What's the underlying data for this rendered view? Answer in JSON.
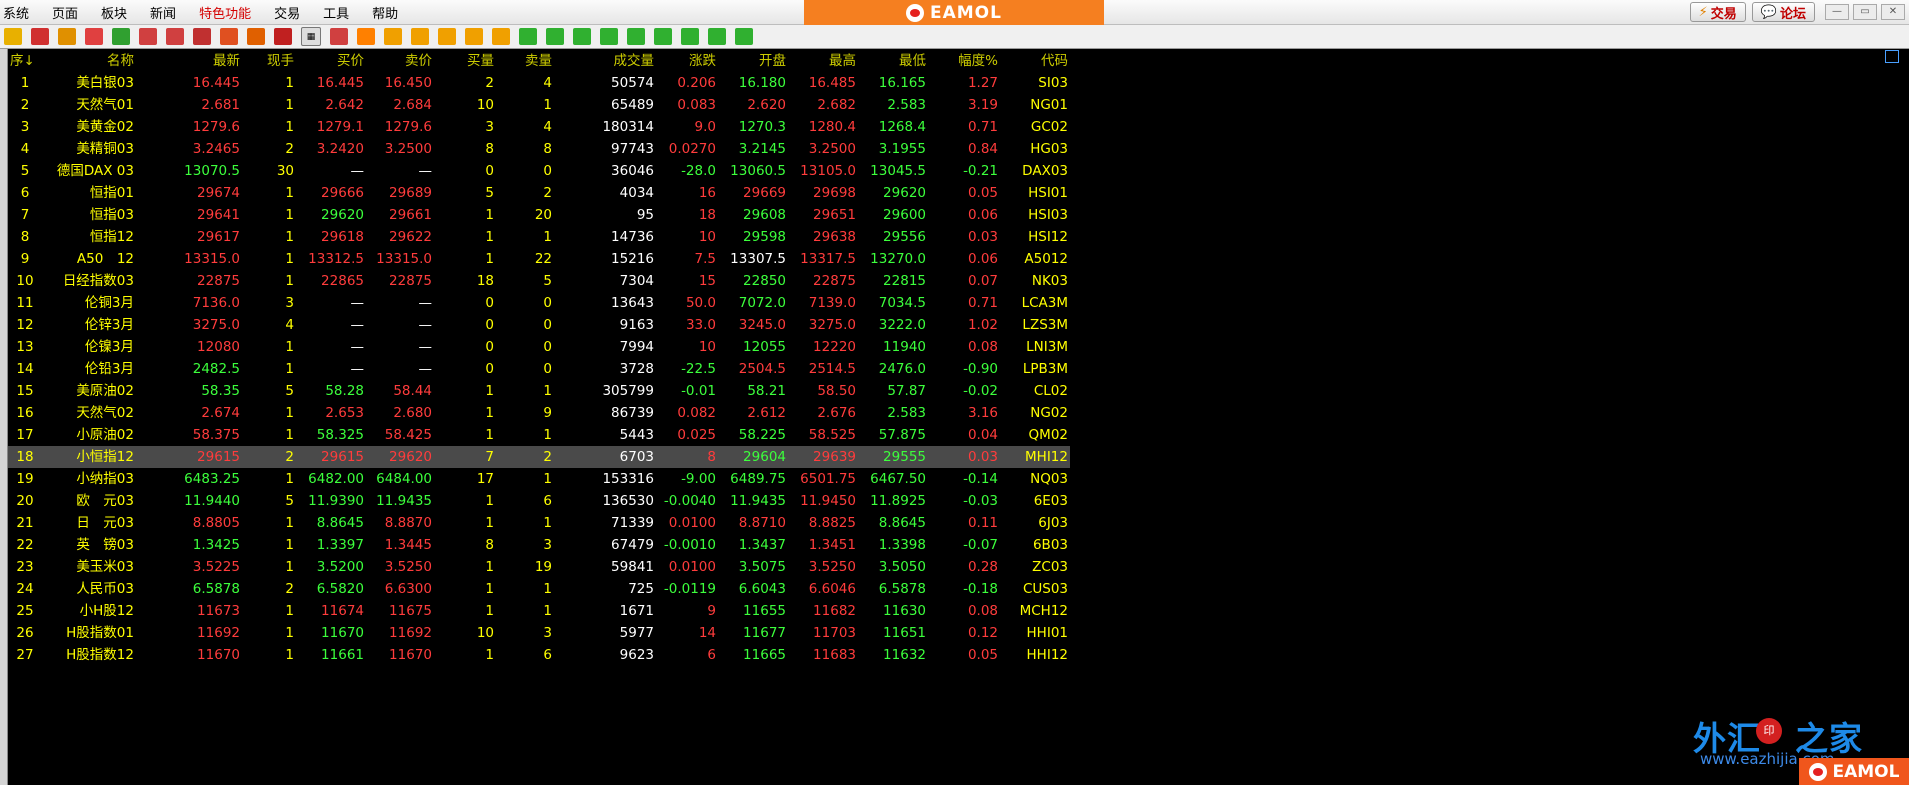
{
  "menu": {
    "items": [
      "系统",
      "页面",
      "板块",
      "新闻",
      "特色功能",
      "交易",
      "工具",
      "帮助"
    ],
    "highlight_index": 4
  },
  "brand": {
    "text": "EAMOL"
  },
  "top_right": {
    "trade_label": "交易",
    "forum_label": "论坛"
  },
  "toolbar_icons": [
    {
      "icon": "folder-icon",
      "color": "#e8b000",
      "label": ""
    },
    {
      "icon": "home-icon",
      "color": "#d03030",
      "label": ""
    },
    {
      "icon": "book-icon",
      "color": "#e09000",
      "label": ""
    },
    {
      "icon": "card-icon",
      "color": "#e04040",
      "label": ""
    },
    {
      "icon": "refresh-icon",
      "color": "#30a030",
      "label": ""
    },
    {
      "icon": "zoom-in-icon",
      "color": "#d04040",
      "label": ""
    },
    {
      "icon": "zoom-out-icon",
      "color": "#d04040",
      "label": ""
    },
    {
      "icon": "window-icon",
      "color": "#c03030",
      "label": ""
    },
    {
      "icon": "pen-icon",
      "color": "#e05020",
      "label": ""
    },
    {
      "icon": "paint-icon",
      "color": "#e06000",
      "label": ""
    },
    {
      "icon": "filter-icon",
      "color": "#c02020",
      "label": ""
    },
    {
      "icon": "table-view-icon",
      "color": "#888888",
      "label": ""
    },
    {
      "icon": "line-chart-icon",
      "color": "#d04040",
      "label": ""
    },
    {
      "icon": "minute-chart-icon",
      "color": "#ff8000",
      "label": ""
    },
    {
      "icon": "daily-chart-icon",
      "color": "#f0a000",
      "label": ""
    },
    {
      "icon": "weekly-chart-icon",
      "color": "#f0a000",
      "label": ""
    },
    {
      "icon": "monthly-chart-icon",
      "color": "#f0a000",
      "label": ""
    },
    {
      "icon": "quarterly-chart-icon",
      "color": "#f0a000",
      "label": ""
    },
    {
      "icon": "yearly-chart-icon",
      "color": "#f0a000",
      "label": ""
    },
    {
      "icon": "period-1-icon",
      "color": "#30b030",
      "label": ""
    },
    {
      "icon": "period-3-icon",
      "color": "#30b030",
      "label": ""
    },
    {
      "icon": "period-5-icon",
      "color": "#30b030",
      "label": ""
    },
    {
      "icon": "period-15-icon",
      "color": "#30b030",
      "label": ""
    },
    {
      "icon": "period-30-icon",
      "color": "#30b030",
      "label": ""
    },
    {
      "icon": "period-60-icon",
      "color": "#30b030",
      "label": ""
    },
    {
      "icon": "period-2h-icon",
      "color": "#30b030",
      "label": ""
    },
    {
      "icon": "period-4h-icon",
      "color": "#30b030",
      "label": ""
    },
    {
      "icon": "period-custom-icon",
      "color": "#30b030",
      "label": ""
    }
  ],
  "table": {
    "headers": [
      "序↓",
      "名称",
      "最新",
      "现手",
      "买价",
      "卖价",
      "买量",
      "卖量",
      "成交量",
      "涨跌",
      "开盘",
      "最高",
      "最低",
      "幅度%",
      "代码"
    ],
    "selected_row": 17,
    "rows": [
      {
        "idx": "1",
        "name": "美白银03",
        "last": "16.445",
        "hand": "1",
        "bid": "16.445",
        "ask": "16.450",
        "bidv": "2",
        "askv": "4",
        "vol": "50574",
        "chg": "0.206",
        "open": "16.180",
        "high": "16.485",
        "low": "16.165",
        "pct": "1.27",
        "code": "SI03",
        "dir": "up",
        "open_dir": "down",
        "high_dir": "up",
        "low_dir": "down",
        "bid_dir": "up",
        "ask_dir": "up"
      },
      {
        "idx": "2",
        "name": "天然气01",
        "last": "2.681",
        "hand": "1",
        "bid": "2.642",
        "ask": "2.684",
        "bidv": "10",
        "askv": "1",
        "vol": "65489",
        "chg": "0.083",
        "open": "2.620",
        "high": "2.682",
        "low": "2.583",
        "pct": "3.19",
        "code": "NG01",
        "dir": "up",
        "open_dir": "up",
        "high_dir": "up",
        "low_dir": "down",
        "bid_dir": "up",
        "ask_dir": "up"
      },
      {
        "idx": "3",
        "name": "美黄金02",
        "last": "1279.6",
        "hand": "1",
        "bid": "1279.1",
        "ask": "1279.6",
        "bidv": "3",
        "askv": "4",
        "vol": "180314",
        "chg": "9.0",
        "open": "1270.3",
        "high": "1280.4",
        "low": "1268.4",
        "pct": "0.71",
        "code": "GC02",
        "dir": "up",
        "open_dir": "down",
        "high_dir": "up",
        "low_dir": "down",
        "bid_dir": "up",
        "ask_dir": "up"
      },
      {
        "idx": "4",
        "name": "美精铜03",
        "last": "3.2465",
        "hand": "2",
        "bid": "3.2420",
        "ask": "3.2500",
        "bidv": "8",
        "askv": "8",
        "vol": "97743",
        "chg": "0.0270",
        "open": "3.2145",
        "high": "3.2500",
        "low": "3.1955",
        "pct": "0.84",
        "code": "HG03",
        "dir": "up",
        "open_dir": "down",
        "high_dir": "up",
        "low_dir": "down",
        "bid_dir": "up",
        "ask_dir": "up"
      },
      {
        "idx": "5",
        "name": "德国DAX 03",
        "last": "13070.5",
        "hand": "30",
        "bid": "—",
        "ask": "—",
        "bidv": "0",
        "askv": "0",
        "vol": "36046",
        "chg": "-28.0",
        "open": "13060.5",
        "high": "13105.0",
        "low": "13045.5",
        "pct": "-0.21",
        "code": "DAX03",
        "dir": "down",
        "open_dir": "down",
        "high_dir": "up",
        "low_dir": "down",
        "bid_dir": "neu",
        "ask_dir": "neu"
      },
      {
        "idx": "6",
        "name": "恒指01",
        "last": "29674",
        "hand": "1",
        "bid": "29666",
        "ask": "29689",
        "bidv": "5",
        "askv": "2",
        "vol": "4034",
        "chg": "16",
        "open": "29669",
        "high": "29698",
        "low": "29620",
        "pct": "0.05",
        "code": "HSI01",
        "dir": "up",
        "open_dir": "up",
        "high_dir": "up",
        "low_dir": "down",
        "bid_dir": "up",
        "ask_dir": "up"
      },
      {
        "idx": "7",
        "name": "恒指03",
        "last": "29641",
        "hand": "1",
        "bid": "29620",
        "ask": "29661",
        "bidv": "1",
        "askv": "20",
        "vol": "95",
        "chg": "18",
        "open": "29608",
        "high": "29651",
        "low": "29600",
        "pct": "0.06",
        "code": "HSI03",
        "dir": "up",
        "open_dir": "down",
        "high_dir": "up",
        "low_dir": "down",
        "bid_dir": "down",
        "ask_dir": "up"
      },
      {
        "idx": "8",
        "name": "恒指12",
        "last": "29617",
        "hand": "1",
        "bid": "29618",
        "ask": "29622",
        "bidv": "1",
        "askv": "1",
        "vol": "14736",
        "chg": "10",
        "open": "29598",
        "high": "29638",
        "low": "29556",
        "pct": "0.03",
        "code": "HSI12",
        "dir": "up",
        "open_dir": "down",
        "high_dir": "up",
        "low_dir": "down",
        "bid_dir": "up",
        "ask_dir": "up"
      },
      {
        "idx": "9",
        "name": "A50　12",
        "last": "13315.0",
        "hand": "1",
        "bid": "13312.5",
        "ask": "13315.0",
        "bidv": "1",
        "askv": "22",
        "vol": "15216",
        "chg": "7.5",
        "open": "13307.5",
        "high": "13317.5",
        "low": "13270.0",
        "pct": "0.06",
        "code": "A5012",
        "dir": "up",
        "open_dir": "neu",
        "high_dir": "up",
        "low_dir": "down",
        "bid_dir": "up",
        "ask_dir": "up"
      },
      {
        "idx": "10",
        "name": "日经指数03",
        "last": "22875",
        "hand": "1",
        "bid": "22865",
        "ask": "22875",
        "bidv": "18",
        "askv": "5",
        "vol": "7304",
        "chg": "15",
        "open": "22850",
        "high": "22875",
        "low": "22815",
        "pct": "0.07",
        "code": "NK03",
        "dir": "up",
        "open_dir": "down",
        "high_dir": "up",
        "low_dir": "down",
        "bid_dir": "up",
        "ask_dir": "up"
      },
      {
        "idx": "11",
        "name": "伦铜3月",
        "last": "7136.0",
        "hand": "3",
        "bid": "—",
        "ask": "—",
        "bidv": "0",
        "askv": "0",
        "vol": "13643",
        "chg": "50.0",
        "open": "7072.0",
        "high": "7139.0",
        "low": "7034.5",
        "pct": "0.71",
        "code": "LCA3M",
        "dir": "up",
        "open_dir": "down",
        "high_dir": "up",
        "low_dir": "down",
        "bid_dir": "neu",
        "ask_dir": "neu"
      },
      {
        "idx": "12",
        "name": "伦锌3月",
        "last": "3275.0",
        "hand": "4",
        "bid": "—",
        "ask": "—",
        "bidv": "0",
        "askv": "0",
        "vol": "9163",
        "chg": "33.0",
        "open": "3245.0",
        "high": "3275.0",
        "low": "3222.0",
        "pct": "1.02",
        "code": "LZS3M",
        "dir": "up",
        "open_dir": "up",
        "high_dir": "up",
        "low_dir": "down",
        "bid_dir": "neu",
        "ask_dir": "neu"
      },
      {
        "idx": "13",
        "name": "伦镍3月",
        "last": "12080",
        "hand": "1",
        "bid": "—",
        "ask": "—",
        "bidv": "0",
        "askv": "0",
        "vol": "7994",
        "chg": "10",
        "open": "12055",
        "high": "12220",
        "low": "11940",
        "pct": "0.08",
        "code": "LNI3M",
        "dir": "up",
        "open_dir": "down",
        "high_dir": "up",
        "low_dir": "down",
        "bid_dir": "neu",
        "ask_dir": "neu"
      },
      {
        "idx": "14",
        "name": "伦铅3月",
        "last": "2482.5",
        "hand": "1",
        "bid": "—",
        "ask": "—",
        "bidv": "0",
        "askv": "0",
        "vol": "3728",
        "chg": "-22.5",
        "open": "2504.5",
        "high": "2514.5",
        "low": "2476.0",
        "pct": "-0.90",
        "code": "LPB3M",
        "dir": "down",
        "open_dir": "up",
        "high_dir": "up",
        "low_dir": "down",
        "bid_dir": "neu",
        "ask_dir": "neu"
      },
      {
        "idx": "15",
        "name": "美原油02",
        "last": "58.35",
        "hand": "5",
        "bid": "58.28",
        "ask": "58.44",
        "bidv": "1",
        "askv": "1",
        "vol": "305799",
        "chg": "-0.01",
        "open": "58.21",
        "high": "58.50",
        "low": "57.87",
        "pct": "-0.02",
        "code": "CL02",
        "dir": "down",
        "open_dir": "down",
        "high_dir": "up",
        "low_dir": "down",
        "bid_dir": "down",
        "ask_dir": "up"
      },
      {
        "idx": "16",
        "name": "天然气02",
        "last": "2.674",
        "hand": "1",
        "bid": "2.653",
        "ask": "2.680",
        "bidv": "1",
        "askv": "9",
        "vol": "86739",
        "chg": "0.082",
        "open": "2.612",
        "high": "2.676",
        "low": "2.583",
        "pct": "3.16",
        "code": "NG02",
        "dir": "up",
        "open_dir": "up",
        "high_dir": "up",
        "low_dir": "down",
        "bid_dir": "up",
        "ask_dir": "up"
      },
      {
        "idx": "17",
        "name": "小原油02",
        "last": "58.375",
        "hand": "1",
        "bid": "58.325",
        "ask": "58.425",
        "bidv": "1",
        "askv": "1",
        "vol": "5443",
        "chg": "0.025",
        "open": "58.225",
        "high": "58.525",
        "low": "57.875",
        "pct": "0.04",
        "code": "QM02",
        "dir": "up",
        "open_dir": "down",
        "high_dir": "up",
        "low_dir": "down",
        "bid_dir": "down",
        "ask_dir": "up"
      },
      {
        "idx": "18",
        "name": "小恒指12",
        "last": "29615",
        "hand": "2",
        "bid": "29615",
        "ask": "29620",
        "bidv": "7",
        "askv": "2",
        "vol": "6703",
        "chg": "8",
        "open": "29604",
        "high": "29639",
        "low": "29555",
        "pct": "0.03",
        "code": "MHI12",
        "dir": "up",
        "open_dir": "down",
        "high_dir": "up",
        "low_dir": "down",
        "bid_dir": "up",
        "ask_dir": "up"
      },
      {
        "idx": "19",
        "name": "小纳指03",
        "last": "6483.25",
        "hand": "1",
        "bid": "6482.00",
        "ask": "6484.00",
        "bidv": "17",
        "askv": "1",
        "vol": "153316",
        "chg": "-9.00",
        "open": "6489.75",
        "high": "6501.75",
        "low": "6467.50",
        "pct": "-0.14",
        "code": "NQ03",
        "dir": "down",
        "open_dir": "down",
        "high_dir": "up",
        "low_dir": "down",
        "bid_dir": "down",
        "ask_dir": "down"
      },
      {
        "idx": "20",
        "name": "欧　元03",
        "last": "11.9440",
        "hand": "5",
        "bid": "11.9390",
        "ask": "11.9435",
        "bidv": "1",
        "askv": "6",
        "vol": "136530",
        "chg": "-0.0040",
        "open": "11.9435",
        "high": "11.9450",
        "low": "11.8925",
        "pct": "-0.03",
        "code": "6E03",
        "dir": "down",
        "open_dir": "down",
        "high_dir": "up",
        "low_dir": "down",
        "bid_dir": "down",
        "ask_dir": "down"
      },
      {
        "idx": "21",
        "name": "日　元03",
        "last": "8.8805",
        "hand": "1",
        "bid": "8.8645",
        "ask": "8.8870",
        "bidv": "1",
        "askv": "1",
        "vol": "71339",
        "chg": "0.0100",
        "open": "8.8710",
        "high": "8.8825",
        "low": "8.8645",
        "pct": "0.11",
        "code": "6J03",
        "dir": "up",
        "open_dir": "up",
        "high_dir": "up",
        "low_dir": "down",
        "bid_dir": "down",
        "ask_dir": "up"
      },
      {
        "idx": "22",
        "name": "英　镑03",
        "last": "1.3425",
        "hand": "1",
        "bid": "1.3397",
        "ask": "1.3445",
        "bidv": "8",
        "askv": "3",
        "vol": "67479",
        "chg": "-0.0010",
        "open": "1.3437",
        "high": "1.3451",
        "low": "1.3398",
        "pct": "-0.07",
        "code": "6B03",
        "dir": "down",
        "open_dir": "down",
        "high_dir": "up",
        "low_dir": "down",
        "bid_dir": "down",
        "ask_dir": "up"
      },
      {
        "idx": "23",
        "name": "美玉米03",
        "last": "3.5225",
        "hand": "1",
        "bid": "3.5200",
        "ask": "3.5250",
        "bidv": "1",
        "askv": "19",
        "vol": "59841",
        "chg": "0.0100",
        "open": "3.5075",
        "high": "3.5250",
        "low": "3.5050",
        "pct": "0.28",
        "code": "ZC03",
        "dir": "up",
        "open_dir": "down",
        "high_dir": "up",
        "low_dir": "down",
        "bid_dir": "down",
        "ask_dir": "up"
      },
      {
        "idx": "24",
        "name": "人民币03",
        "last": "6.5878",
        "hand": "2",
        "bid": "6.5820",
        "ask": "6.6300",
        "bidv": "1",
        "askv": "1",
        "vol": "725",
        "chg": "-0.0119",
        "open": "6.6043",
        "high": "6.6046",
        "low": "6.5878",
        "pct": "-0.18",
        "code": "CUS03",
        "dir": "down",
        "open_dir": "down",
        "high_dir": "up",
        "low_dir": "down",
        "bid_dir": "down",
        "ask_dir": "up"
      },
      {
        "idx": "25",
        "name": "小H股12",
        "last": "11673",
        "hand": "1",
        "bid": "11674",
        "ask": "11675",
        "bidv": "1",
        "askv": "1",
        "vol": "1671",
        "chg": "9",
        "open": "11655",
        "high": "11682",
        "low": "11630",
        "pct": "0.08",
        "code": "MCH12",
        "dir": "up",
        "open_dir": "down",
        "high_dir": "up",
        "low_dir": "down",
        "bid_dir": "up",
        "ask_dir": "up"
      },
      {
        "idx": "26",
        "name": "H股指数01",
        "last": "11692",
        "hand": "1",
        "bid": "11670",
        "ask": "11692",
        "bidv": "10",
        "askv": "3",
        "vol": "5977",
        "chg": "14",
        "open": "11677",
        "high": "11703",
        "low": "11651",
        "pct": "0.12",
        "code": "HHI01",
        "dir": "up",
        "open_dir": "down",
        "high_dir": "up",
        "low_dir": "down",
        "bid_dir": "down",
        "ask_dir": "up"
      },
      {
        "idx": "27",
        "name": "H股指数12",
        "last": "11670",
        "hand": "1",
        "bid": "11661",
        "ask": "11670",
        "bidv": "1",
        "askv": "6",
        "vol": "9623",
        "chg": "6",
        "open": "11665",
        "high": "11683",
        "low": "11632",
        "pct": "0.05",
        "code": "HHI12",
        "dir": "up",
        "open_dir": "down",
        "high_dir": "up",
        "low_dir": "down",
        "bid_dir": "down",
        "ask_dir": "up"
      }
    ]
  },
  "watermark": {
    "text_a": "外汇",
    "seal": "印",
    "text_b": "之家",
    "url": "www.eazhijia.com",
    "corner": "EAMOL"
  }
}
